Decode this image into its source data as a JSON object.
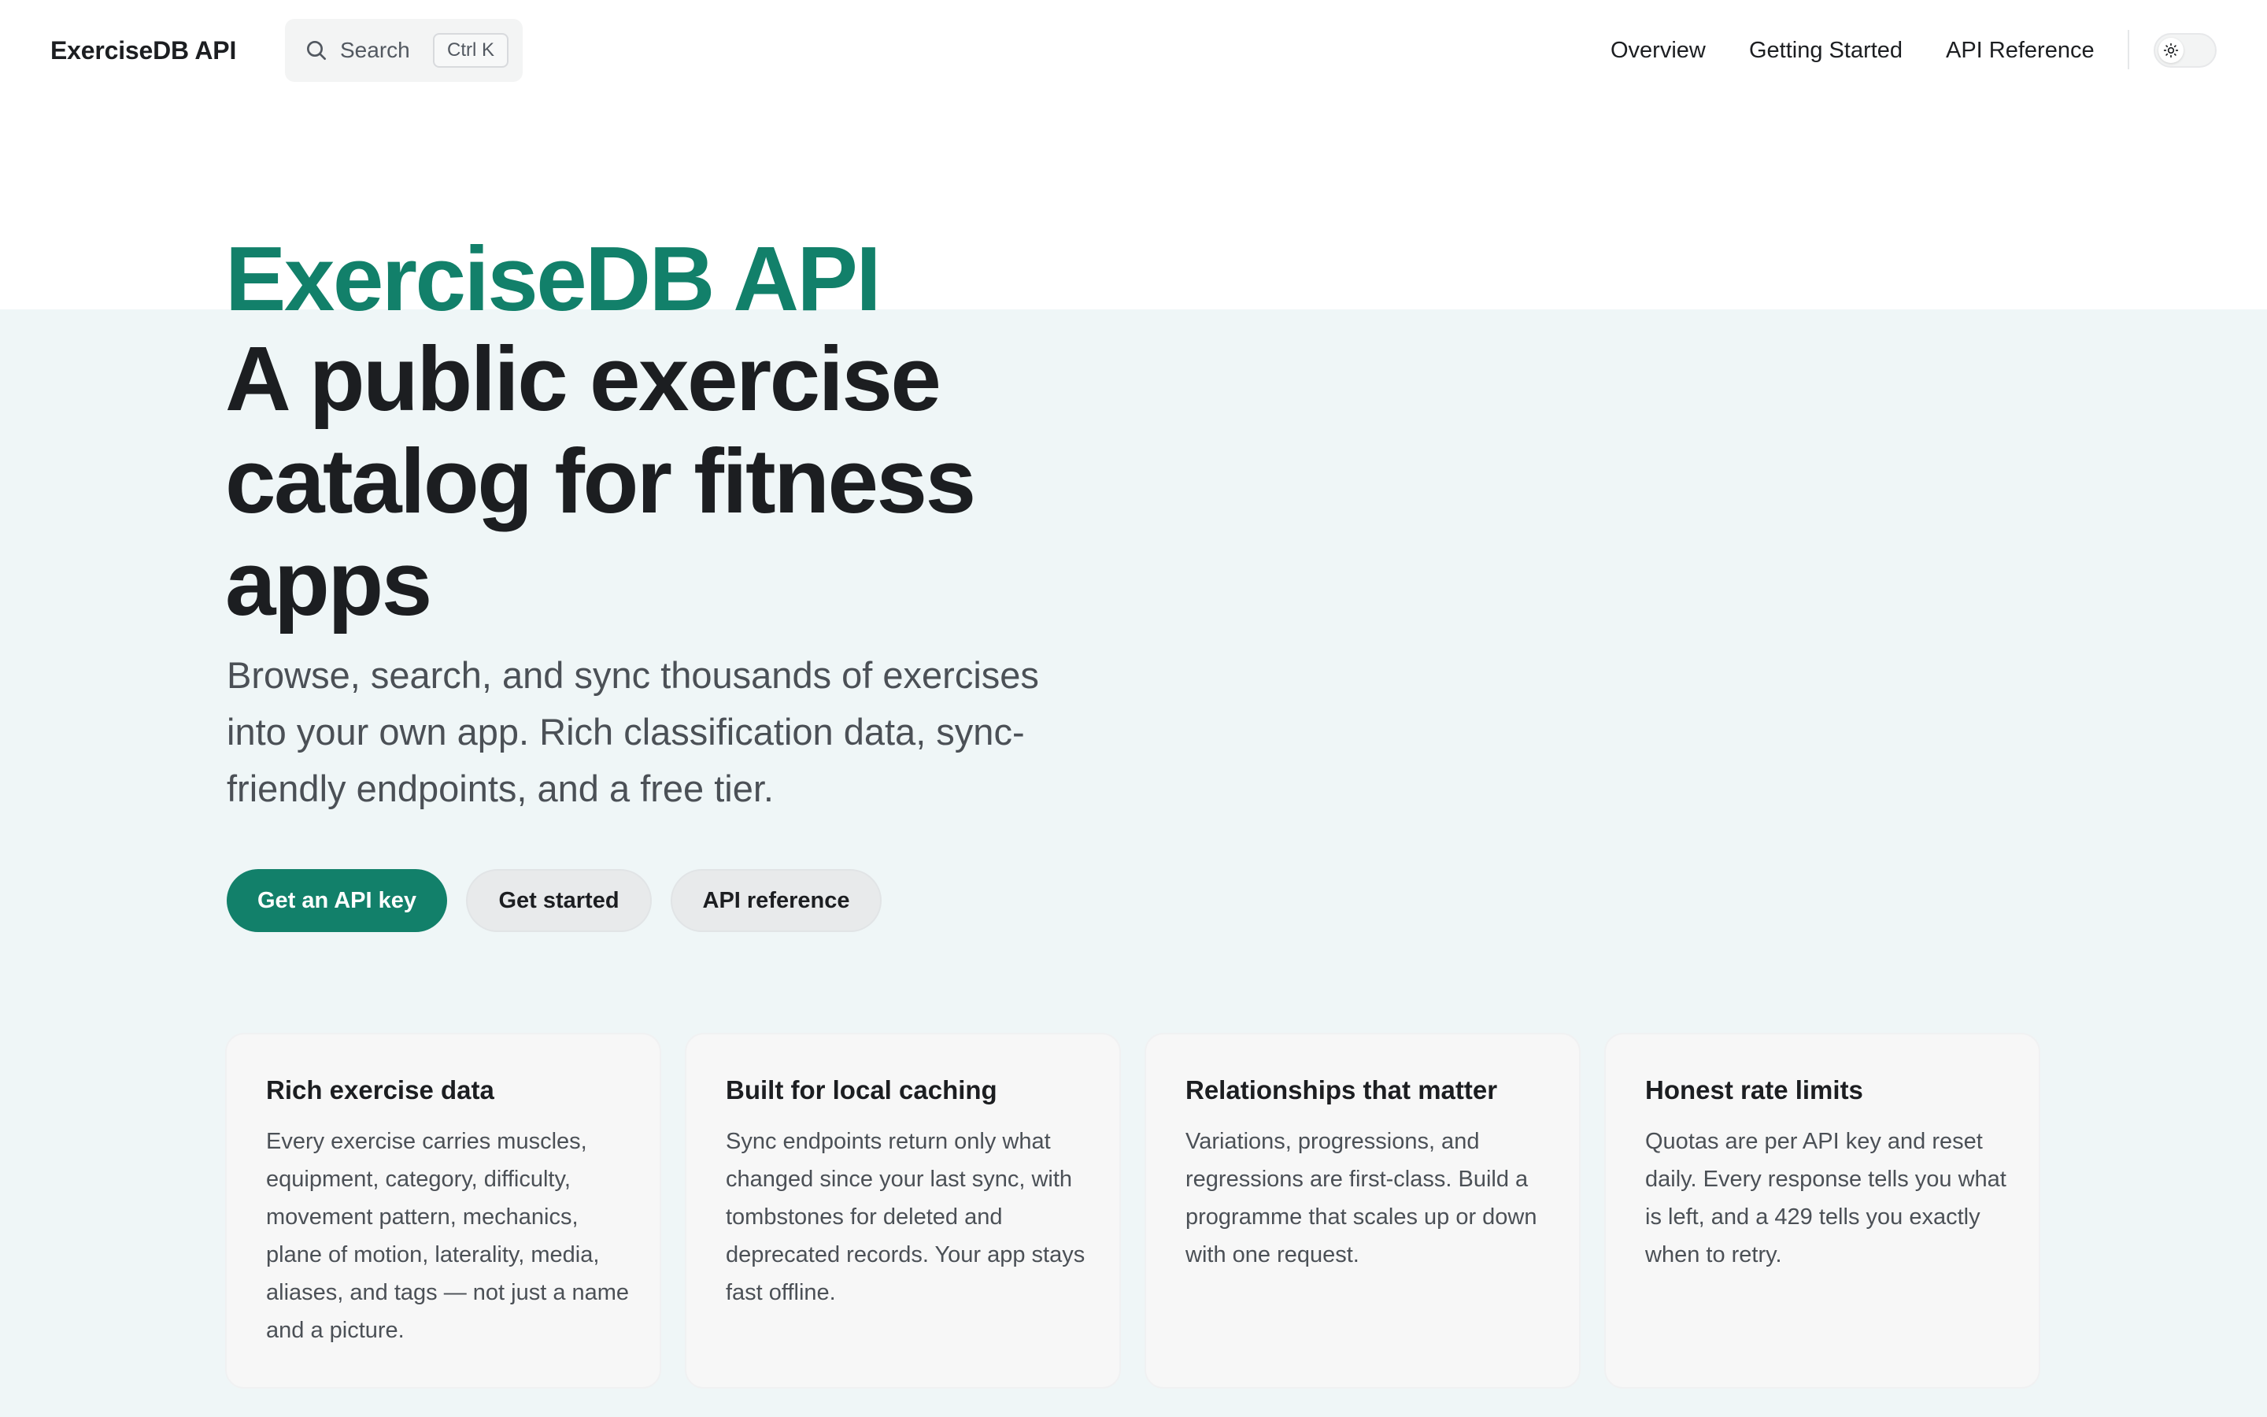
{
  "header": {
    "brand": "ExerciseDB API",
    "search": {
      "label": "Search",
      "shortcut": "Ctrl K",
      "icon": "search-icon"
    },
    "nav": {
      "overview": "Overview",
      "getting_started": "Getting Started",
      "api_reference": "API Reference"
    },
    "theme_toggle": {
      "icon": "sun-icon"
    }
  },
  "hero": {
    "title": "ExerciseDB API",
    "subtitle": "A public exercise catalog for fitness apps",
    "description": "Browse, search, and sync thousands of exercises into your own app. Rich classification data, sync-friendly endpoints, and a free tier.",
    "buttons": {
      "primary": "Get an API key",
      "started": "Get started",
      "reference": "API reference"
    }
  },
  "features": [
    {
      "title": "Rich exercise data",
      "body": "Every exercise carries muscles, equipment, category, difficulty, movement pattern, mechanics, plane of motion, laterality, media, aliases, and tags — not just a name and a picture."
    },
    {
      "title": "Built for local caching",
      "body": "Sync endpoints return only what changed since your last sync, with tombstones for deleted and deprecated records. Your app stays fast offline."
    },
    {
      "title": "Relationships that matter",
      "body": "Variations, progressions, and regressions are first-class. Build a programme that scales up or down with one request."
    },
    {
      "title": "Honest rate limits",
      "body": "Quotas are per API key and reset daily. Every response tells you what is left, and a 429 tells you exactly when to retry."
    }
  ],
  "colors": {
    "accent": "#12806a",
    "hero_background": "#eff6f7",
    "card_background": "#f7f7f7",
    "text_primary": "#1c1e21",
    "text_secondary": "#4b5056"
  }
}
